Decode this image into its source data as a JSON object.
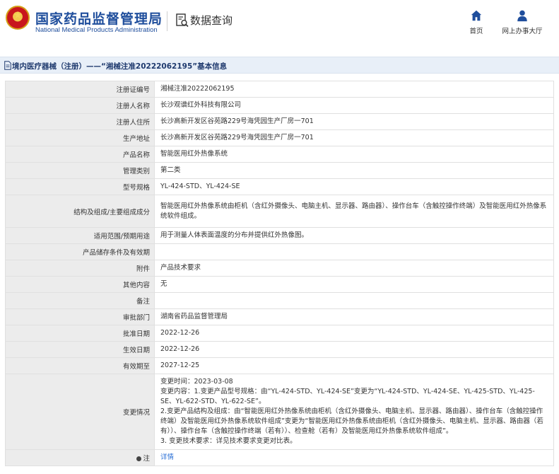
{
  "header": {
    "brand_cn": "国家药品监督管理局",
    "brand_en": "National Medical Products Administration",
    "section_title": "数据查询",
    "nav": [
      {
        "label": "首页",
        "icon": "home-icon"
      },
      {
        "label": "网上办事大厅",
        "icon": "user-icon"
      }
    ]
  },
  "title_bar": {
    "text": "境内医疗器械（注册）——“湘械注准20222062195”基本信息",
    "icon": "document-icon"
  },
  "fields": {
    "reg_no_label": "注册证编号",
    "reg_no": "湘械注准20222062195",
    "registrant_label": "注册人名称",
    "registrant": "长沙观谱红外科技有限公司",
    "residence_label": "注册人住所",
    "residence": "长沙高新开发区谷苑路229号海凭园生产厂房一701",
    "production_label": "生产地址",
    "production": "长沙高新开发区谷苑路229号海凭园生产厂房一701",
    "product_name_label": "产品名称",
    "product_name": "智能医用红外热像系统",
    "category_label": "管理类别",
    "category": "第二类",
    "model_label": "型号规格",
    "model": "YL-424-STD、YL-424-SE",
    "structure_label": "结构及组成/主要组成成分",
    "structure": "智能医用红外热像系统由柜机（含红外摄像头、电脑主机、显示器、路由器）、操作台车（含触控操作终端）及智能医用红外热像系统软件组成。",
    "scope_label": "适用范围/预期用途",
    "scope": "用于测量人体表面温度的分布并提供红外热像图。",
    "storage_label": "产品储存条件及有效期",
    "storage": "",
    "attachment_label": "附件",
    "attachment": "产品技术要求",
    "other_label": "其他内容",
    "other": "无",
    "remark_label": "备注",
    "remark": "",
    "approver_label": "审批部门",
    "approver": "湖南省药品监督管理局",
    "approve_date_label": "批准日期",
    "approve_date": "2022-12-26",
    "effective_date_label": "生效日期",
    "effective_date": "2022-12-26",
    "expiry_label": "有效期至",
    "expiry": "2027-12-25",
    "change_label": "变更情况",
    "change_lines": [
      "变更时间：2023-03-08",
      "变更内容：1.变更产品型号规格：由“YL-424-STD、YL-424-SE”变更为“YL-424-STD、YL-424-SE、YL-425-STD、YL-425-SE、YL-622-STD、YL-622-SE”。",
      "2.变更产品结构及组成：由“智能医用红外热像系统由柜机（含红外摄像头、电脑主机、显示器、路由器）、操作台车（含触控操作终端）及智能医用红外热像系统软件组成”变更为“智能医用红外热像系统由柜机（含红外摄像头、电脑主机、显示器、路由器（若有））、操作台车（含触控操作终端（若有））、检查舱（若有）及智能医用红外热像系统软件组成”。",
      "3. 变更技术要求：详见技术要求变更对比表。"
    ],
    "note_label": "注",
    "note_link": "详情"
  }
}
